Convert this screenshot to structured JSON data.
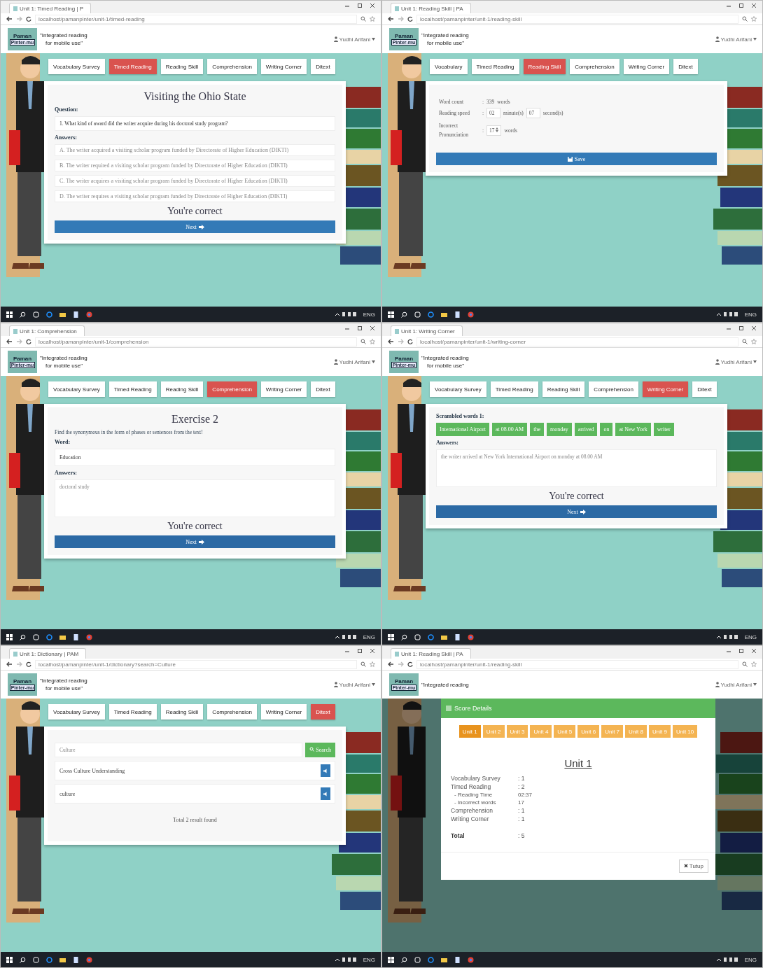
{
  "panels": [
    {
      "kind": "quiz",
      "browser": {
        "tab_title": "Unit 1: Timed Reading | P",
        "url": "localhost/pamanpinter/unit-1/timed-reading"
      },
      "header": {
        "logo": [
          "Paman",
          "Pinter-mu"
        ],
        "tagline": [
          "\"Integrated reading",
          "for mobile use\""
        ],
        "user": "Yudhi Arifani"
      },
      "nav": [
        {
          "label": "Vocabulary Survey",
          "selected": false
        },
        {
          "label": "Timed Reading",
          "selected": true
        },
        {
          "label": "Reading Skill",
          "selected": false
        },
        {
          "label": "Comprehension",
          "selected": false
        },
        {
          "label": "Writing Corner",
          "selected": false
        },
        {
          "label": "Ditext",
          "selected": false
        }
      ],
      "content": {
        "title": "Visiting the Ohio State",
        "question_label": "Question:",
        "question": "1. What kind of award did the writer acquire during his doctoral study program?",
        "answers_label": "Answers:",
        "answers": [
          "A. The writer acquired a visiting scholar program funded by Directorate of Higher Education (DIKTI)",
          "B. The writer required a visiting scholar program funded by Directorate of Higher Education (DIKTI)",
          "C. The writer acquires a visiting scholar program funded by Directorate of Higher Education (DIKTI)",
          "D. The writer requires a visiting scholar program funded by Directorate of Higher Education (DIKTI)"
        ],
        "feedback": "You're correct",
        "button": "Next"
      },
      "taskbar": {
        "lang": "ENG"
      }
    },
    {
      "kind": "reading_form",
      "browser": {
        "tab_title": "Unit 1: Reading Skill | PA",
        "url": "localhost/pamanpinter/unit-1/reading-skill"
      },
      "header": {
        "logo": [
          "Paman",
          "Pinter-mu"
        ],
        "tagline": [
          "\"Integrated reading",
          "for mobile use\""
        ],
        "user": "Yudhi Arifani"
      },
      "nav": [
        {
          "label": "Vocabulary",
          "selected": false
        },
        {
          "label": "Timed Reading",
          "selected": false
        },
        {
          "label": "Reading Skill",
          "selected": true
        },
        {
          "label": "Comprehension",
          "selected": false
        },
        {
          "label": "Writing Corner",
          "selected": false
        },
        {
          "label": "Ditext",
          "selected": false
        }
      ],
      "content": {
        "separator": ":",
        "word_count_label": "Word count",
        "word_count": "339",
        "words_unit": "words",
        "speed_label": "Reading speed",
        "minutes": "02",
        "minutes_unit": "minute(s)",
        "seconds": "07",
        "seconds_unit": "second(s)",
        "incorrect_label": [
          "Incorrect",
          "Pronunciation"
        ],
        "incorrect": "17",
        "incorrect_unit": "words",
        "button": "Save"
      },
      "taskbar": {
        "lang": "ENG"
      }
    },
    {
      "kind": "exercise",
      "browser": {
        "tab_title": "Unit 1: Comprehension",
        "url": "localhost/pamanpinter/unit-1/comprehension"
      },
      "header": {
        "logo": [
          "Paman",
          "Pinter-mu"
        ],
        "tagline": [
          "\"Integrated reading",
          "for mobile use\""
        ],
        "user": "Yudhi Arifani"
      },
      "nav": [
        {
          "label": "Vocabulary Survey",
          "selected": false
        },
        {
          "label": "Timed Reading",
          "selected": false
        },
        {
          "label": "Reading Skill",
          "selected": false
        },
        {
          "label": "Comprehension",
          "selected": true
        },
        {
          "label": "Writing Corner",
          "selected": false
        },
        {
          "label": "Ditext",
          "selected": false
        }
      ],
      "content": {
        "title": "Exercise 2",
        "instruction": "Find the synonymous in the form of phases or sentences from the text!",
        "word_label": "Word:",
        "word": "Education",
        "answers_label": "Answers:",
        "answer": "doctoral study",
        "feedback": "You're correct",
        "button": "Next"
      },
      "taskbar": {
        "lang": "ENG"
      }
    },
    {
      "kind": "scramble",
      "browser": {
        "tab_title": "Unit 1: Writing Corner",
        "url": "localhost/pamanpinter/unit-1/writing-corner"
      },
      "header": {
        "logo": [
          "Paman",
          "Pinter-mu"
        ],
        "tagline": [
          "\"Integrated reading",
          "for mobile use\""
        ],
        "user": "Yudhi Arifani"
      },
      "nav": [
        {
          "label": "Vocabulary Survey",
          "selected": false
        },
        {
          "label": "Timed Reading",
          "selected": false
        },
        {
          "label": "Reading Skill",
          "selected": false
        },
        {
          "label": "Comprehension",
          "selected": false
        },
        {
          "label": "Writing Corner",
          "selected": true
        },
        {
          "label": "Ditext",
          "selected": false
        }
      ],
      "content": {
        "label": "Scrambled words 1:",
        "chips": [
          "International Airport",
          "at 08.00 AM",
          "the",
          "monday",
          "arrived",
          "on",
          "at New York",
          "writer"
        ],
        "answers_label": "Answers:",
        "answer": "the writer arrived at New York International Airport on monday at 08.00 AM",
        "feedback": "You're correct",
        "button": "Next"
      },
      "taskbar": {
        "lang": "ENG"
      }
    },
    {
      "kind": "dictionary",
      "browser": {
        "tab_title": "Unit 1: Dictionary | PAM",
        "url": "localhost/pamanpinter/unit-1/dictionary?search=Culture"
      },
      "header": {
        "logo": [
          "Paman",
          "Pinter-mu"
        ],
        "tagline": [
          "\"Integrated reading",
          "for mobile use\""
        ],
        "user": "Yudhi Arifani"
      },
      "nav": [
        {
          "label": "Vocabulary Survey",
          "selected": false
        },
        {
          "label": "Timed Reading",
          "selected": false
        },
        {
          "label": "Reading Skill",
          "selected": false
        },
        {
          "label": "Comprehension",
          "selected": false
        },
        {
          "label": "Writing Corner",
          "selected": false
        },
        {
          "label": "Ditext",
          "selected": true
        }
      ],
      "content": {
        "query": "Culture",
        "button": "Search",
        "results": [
          "Cross Culture Understanding",
          "culture"
        ],
        "total": "Total 2 result found"
      },
      "taskbar": {
        "lang": "ENG"
      }
    },
    {
      "kind": "score_modal",
      "browser": {
        "tab_title": "Unit 1: Reading Skill | PA",
        "url": "localhost/pamanpinter/unit-1/reading-skill"
      },
      "header": {
        "logo": [
          "Paman",
          "Pinter-mu"
        ],
        "tagline": [
          "\"Integrated reading"
        ],
        "user": "Yudhi Arifani"
      },
      "content": {
        "title": "Score Details",
        "units": [
          {
            "label": "Unit 1",
            "selected": true
          },
          {
            "label": "Unit 2",
            "selected": false
          },
          {
            "label": "Unit 3",
            "selected": false
          },
          {
            "label": "Unit 4",
            "selected": false
          },
          {
            "label": "Unit 5",
            "selected": false
          },
          {
            "label": "Unit 6",
            "selected": false
          },
          {
            "label": "Unit 7",
            "selected": false
          },
          {
            "label": "Unit 8",
            "selected": false
          },
          {
            "label": "Unit 9",
            "selected": false
          },
          {
            "label": "Unit 10",
            "selected": false
          }
        ],
        "heading": "Unit 1",
        "rows": [
          {
            "kind": "main",
            "label": "Vocabulary Survey",
            "value": ": 1"
          },
          {
            "kind": "main",
            "label": "Timed Reading",
            "value": ": 2"
          },
          {
            "kind": "sub",
            "label": "- Reading Time",
            "value": "02:37"
          },
          {
            "kind": "sub",
            "label": "- Incorrect words",
            "value": "17"
          },
          {
            "kind": "main",
            "label": "Comprehension",
            "value": ": 1"
          },
          {
            "kind": "main",
            "label": "Writing Corner",
            "value": ": 1"
          },
          {
            "kind": "total",
            "label": "Total",
            "value": ": 5"
          }
        ],
        "button": "Tutup"
      },
      "taskbar": {
        "lang": "ENG"
      }
    }
  ]
}
